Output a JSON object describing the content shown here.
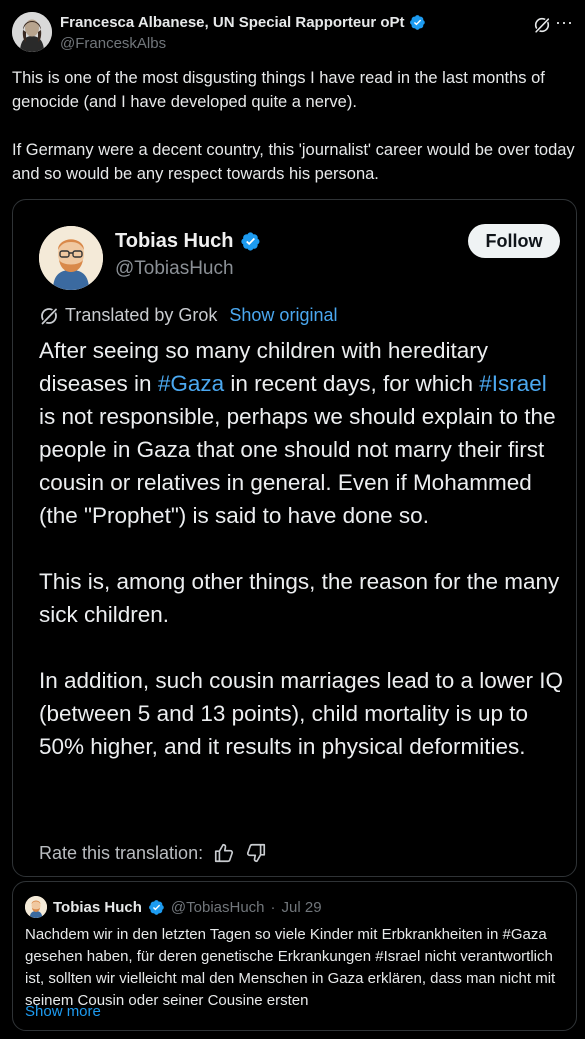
{
  "author": {
    "name": "Francesca Albanese, UN Special Rapporteur oPt",
    "handle": "@FranceskAlbs"
  },
  "tweet": {
    "paragraphs": [
      "This is one of the most disgusting things I have read in the last months of genocide (and I have developed quite a nerve).",
      "If Germany were a decent country, this 'journalist' career would be over today and so would be any respect towards his persona."
    ]
  },
  "media": {
    "name": "Tobias Huch",
    "handle": "@TobiasHuch",
    "follow_label": "Follow",
    "translated_label": "Translated by Grok",
    "show_original_label": "Show original",
    "body": {
      "p1_a": "After seeing so many children with hereditary diseases in ",
      "p1_tag1": "#Gaza",
      "p1_b": " in recent days, for which ",
      "p1_tag2": "#Israel",
      "p1_c": " is not responsible, perhaps we should explain to the people in Gaza that one should not marry their first cousin or relatives in general. Even if Mohammed (the \"Prophet\") is said to have done so.",
      "p2": "This is, among other things, the reason for the many sick children.",
      "p3": "In addition, such cousin marriages lead to a lower IQ (between 5 and 13 points), child mortality is up to 50% higher, and it results in physical deformities."
    },
    "rate_label": "Rate this translation:"
  },
  "quote": {
    "name": "Tobias Huch",
    "handle": "@TobiasHuch",
    "sep": "·",
    "date": "Jul 29",
    "text": "Nachdem wir in den letzten Tagen so viele Kinder mit Erbkrankheiten in #Gaza gesehen haben, für deren genetische Erkrankungen #Israel nicht verantwortlich ist, sollten wir vielleicht mal den Menschen in Gaza erklären, dass man nicht mit seinem Cousin oder seiner Cousine ersten",
    "show_more": "Show more"
  },
  "colors": {
    "background": "#000000",
    "text": "#e7e9ea",
    "secondary": "#71767b",
    "accent": "#1d9bf0",
    "border": "#2f3336"
  },
  "icons": [
    "verified-badge-icon",
    "grok-icon",
    "more-icon",
    "thumbs-up-icon",
    "thumbs-down-icon"
  ]
}
